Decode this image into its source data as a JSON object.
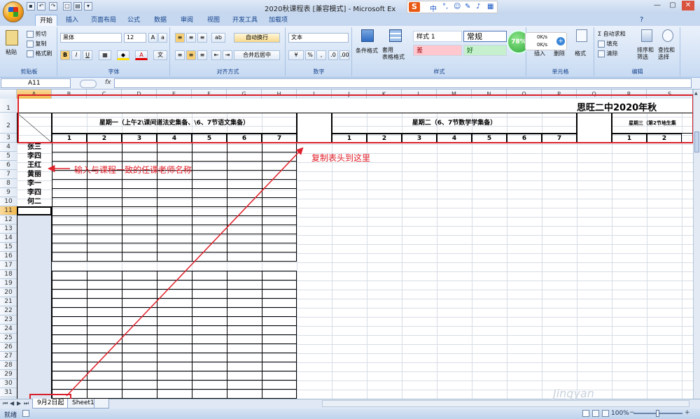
{
  "window": {
    "title": "2020秋课程表 [兼容模式] - Microsoft Ex",
    "mode": ""
  },
  "ime": {
    "logo": "S",
    "items": [
      "中",
      "°,",
      "☺",
      "✎",
      "♪",
      "▦"
    ]
  },
  "ribbon": {
    "tabs": [
      "开始",
      "插入",
      "页面布局",
      "公式",
      "数据",
      "审阅",
      "视图",
      "开发工具",
      "加载项"
    ],
    "active_tab": "开始",
    "clipboard": {
      "paste": "粘贴",
      "cut": "剪切",
      "copy": "复制",
      "format_painter": "格式刷",
      "label": "剪贴板"
    },
    "font": {
      "name": "黑体",
      "size": "12",
      "label": "字体",
      "bold": "B",
      "italic": "I",
      "underline": "U"
    },
    "alignment": {
      "wrap": "自动换行",
      "merge": "合并后居中",
      "label": "对齐方式"
    },
    "number": {
      "format": "文本",
      "percent": "%",
      "comma": ",",
      "label": "数字"
    },
    "styles": {
      "conditional": "条件格式",
      "table": "套用\n表格格式",
      "style1": "样式 1",
      "normal": "常规",
      "bad": "差",
      "good": "好",
      "label": "样式"
    },
    "speed": {
      "percent": "78%",
      "up": "0K/s",
      "down": "0K/s"
    },
    "cells": {
      "insert": "插入",
      "delete": "删除",
      "format": "格式",
      "label": "单元格"
    },
    "editing": {
      "autosum": "自动求和",
      "fill": "填充",
      "clear": "清除",
      "sort": "排序和\n筛选",
      "find": "查找和\n选择",
      "label": "编辑"
    }
  },
  "formula_bar": {
    "name_box": "A11",
    "fx": "fx",
    "content": ""
  },
  "columns": [
    "A",
    "B",
    "C",
    "D",
    "E",
    "F",
    "G",
    "H",
    "I",
    "J",
    "K",
    "L",
    "M",
    "N",
    "O",
    "P",
    "Q",
    "R",
    "S"
  ],
  "rows": [
    "1",
    "2",
    "3",
    "4",
    "5",
    "6",
    "7",
    "8",
    "9",
    "10",
    "11",
    "12",
    "13",
    "14",
    "15",
    "16",
    "17",
    "18",
    "19",
    "20",
    "21",
    "22",
    "23",
    "24",
    "25",
    "26",
    "27",
    "28",
    "29",
    "30",
    "31"
  ],
  "sheet": {
    "title": "思旺二中2020年秋",
    "monday": "星期一（上午2\\课间道法史集备、\\6、7节语文集备）",
    "tuesday": "星期二（6、7节数学学集备）",
    "wednesday": "星期三（第2节地生集",
    "periods": [
      "1",
      "2",
      "3",
      "4",
      "5",
      "6",
      "7"
    ],
    "teachers": [
      "张三",
      "李四",
      "王红",
      "黄丽",
      "李一",
      "李四",
      "何二"
    ]
  },
  "annotations": {
    "teacher_note": "输入与课程一致的任课老师名称",
    "copy_note": "复制表头到这里"
  },
  "sheet_tabs": [
    "9月2日起",
    "Sheet1"
  ],
  "status": {
    "ready": "就绪",
    "zoom": "100%"
  },
  "watermark": "Jingyan"
}
